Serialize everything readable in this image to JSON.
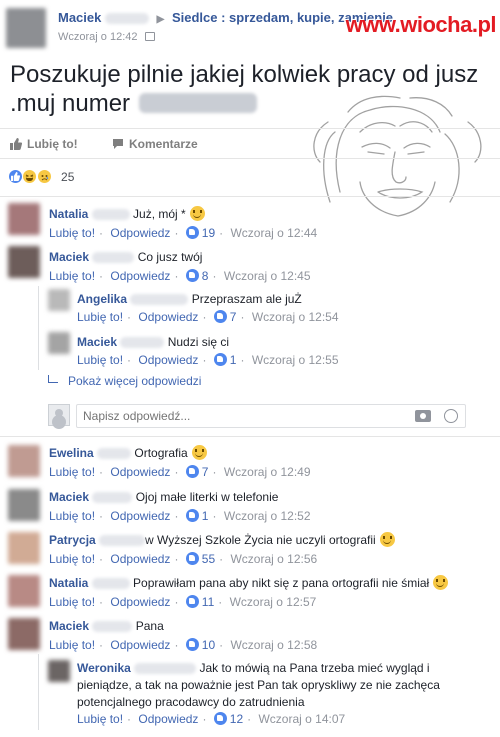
{
  "post": {
    "author": "Maciek",
    "arrow": "▶",
    "group": "Siedlce : sprzedam, kupie, zamienie",
    "time": "Wczoraj o 12:42",
    "text": "Poszukuje pilnie jakiej kolwiek pracy od jusz .muj numer",
    "watermark": "www.wiocha.pl"
  },
  "actions": {
    "like": "Lubię to!",
    "comment": "Komentarze"
  },
  "reactions": {
    "count": "25"
  },
  "labels": {
    "like": "Lubię to!",
    "reply": "Odpowiedz",
    "more_replies": "Pokaż więcej odpowiedzi",
    "reply_placeholder": "Napisz odpowiedź..."
  },
  "comments": [
    {
      "name": "Natalia",
      "text": "Już, mój *",
      "likes": "19",
      "time": "Wczoraj o 12:44",
      "avatar_color": "#a5787a"
    },
    {
      "name": "Maciek",
      "text": "Co jusz twój",
      "likes": "8",
      "time": "Wczoraj o 12:45",
      "avatar_color": "#6d5d5a"
    },
    {
      "name": "Angelika",
      "text": "Przepraszam ale juŻ",
      "likes": "7",
      "time": "Wczoraj o 12:54",
      "avatar_color": "#b9b9b9"
    },
    {
      "name": "Maciek",
      "text": "Nudzi się ci",
      "likes": "1",
      "time": "Wczoraj o 12:55",
      "avatar_color": "#a4a4a4"
    },
    {
      "name": "Ewelina",
      "text": "Ortografia",
      "likes": "7",
      "time": "Wczoraj o 12:49",
      "avatar_color": "#c09b92"
    },
    {
      "name": "Maciek",
      "text": "Ojoj małe literki w telefonie",
      "likes": "1",
      "time": "Wczoraj o 12:52",
      "avatar_color": "#8a8a8a"
    },
    {
      "name": "Patrycja",
      "text": "w Wyższej Szkole Życia nie uczyli ortografii",
      "likes": "55",
      "time": "Wczoraj o 12:56",
      "avatar_color": "#d1ab95"
    },
    {
      "name": "Natalia",
      "text": "Poprawiłam pana aby nikt się z pana ortografii nie śmiał",
      "likes": "11",
      "time": "Wczoraj o 12:57",
      "avatar_color": "#b88a85"
    },
    {
      "name": "Maciek",
      "text": "Pana",
      "likes": "10",
      "time": "Wczoraj o 12:58",
      "avatar_color": "#8c6a66"
    },
    {
      "name": "Weronika",
      "text_lines": [
        "Jak to mówią na Pana trzeba mieć wygląd i",
        "pieniądze, a tak na poważnie jest Pan tak opryskliwy ze nie zachęca",
        "potencjalnego pracodawcy do zatrudnienia"
      ],
      "likes": "12",
      "time": "Wczoraj o 14:07",
      "avatar_color": "#6b6564"
    }
  ]
}
